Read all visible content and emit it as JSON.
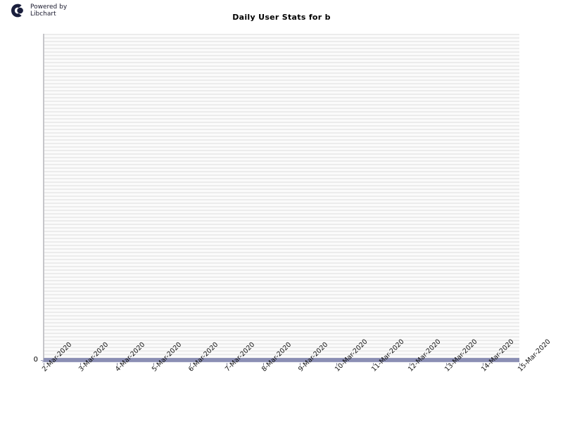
{
  "branding": {
    "logo_icon": "libchart-logo-icon",
    "text": "Powered by\nLibchart",
    "logo_color": "#1a1f3d"
  },
  "header": {
    "title": "Daily User Stats for b"
  },
  "colors": {
    "series": "#8b8fb4",
    "baseline": "#9a9dbe",
    "axis": "#c6c6ca",
    "stripe_dark": "#ececec",
    "stripe_light": "#fbfbfb",
    "text": "#000000"
  },
  "chart_data": {
    "type": "line",
    "title": "Daily User Stats for b",
    "xlabel": "",
    "ylabel": "",
    "categories": [
      "2-Mar-2020",
      "3-Mar-2020",
      "4-Mar-2020",
      "5-Mar-2020",
      "6-Mar-2020",
      "7-Mar-2020",
      "8-Mar-2020",
      "9-Mar-2020",
      "10-Mar-2020",
      "11-Mar-2020",
      "12-Mar-2020",
      "13-Mar-2020",
      "14-Mar-2020",
      "15-Mar-2020"
    ],
    "values": [
      0,
      0,
      0,
      0,
      0,
      0,
      0,
      0,
      0,
      0,
      0,
      0,
      0,
      0
    ],
    "ylim": [
      0,
      0
    ],
    "yticks": [
      "0"
    ],
    "grid": true,
    "legend": "none"
  }
}
